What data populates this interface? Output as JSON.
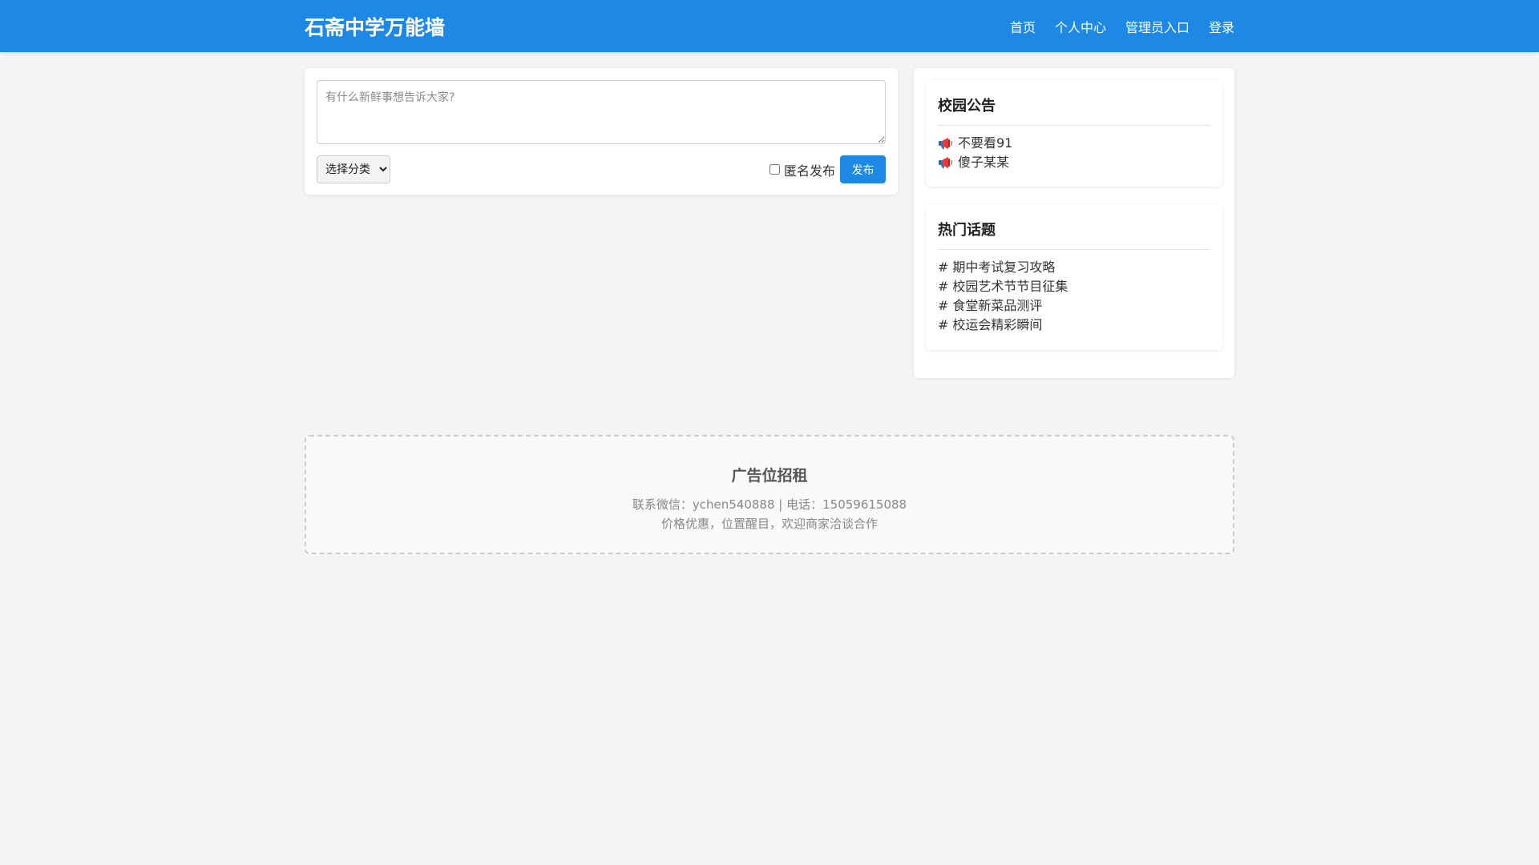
{
  "header": {
    "site_title": "石斋中学万能墙",
    "nav": [
      "首页",
      "个人中心",
      "管理员入口",
      "登录"
    ]
  },
  "post_form": {
    "placeholder": "有什么新鲜事想告诉大家?",
    "category_select": "选择分类",
    "anonymous_label": "匿名发布",
    "anonymous_checked": false,
    "publish_label": "发布"
  },
  "sidebar": {
    "announcements": {
      "title": "校园公告",
      "items": [
        "不要看91",
        "傻子某某"
      ]
    },
    "hot_topics": {
      "title": "热门话题",
      "items": [
        "期中考试复习攻略",
        "校园艺术节节目征集",
        "食堂新菜品测评",
        "校运会精彩瞬间"
      ]
    }
  },
  "ad": {
    "title": "广告位招租",
    "contact": "联系微信：ychen540888 | 电话：15059615088",
    "slogan": "价格优惠，位置醒目，欢迎商家洽谈合作"
  },
  "colors": {
    "primary": "#1e88e5",
    "background": "#f4f4f4"
  },
  "icons": {
    "announcement_item": "megaphone-icon",
    "topic_prefix": "#"
  }
}
